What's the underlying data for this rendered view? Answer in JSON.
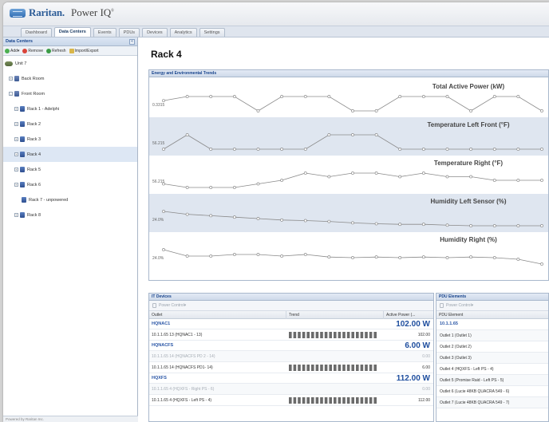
{
  "app": {
    "brand": "Raritan.",
    "product": "Power IQ",
    "trademark": "®"
  },
  "nav": {
    "tabs": [
      "Dashboard",
      "Data Centers",
      "Events",
      "PDUs",
      "Devices",
      "Analytics",
      "Settings"
    ],
    "active": "Data Centers"
  },
  "sidebar": {
    "title": "Data Centers",
    "collapse": "«",
    "toolbar": {
      "add": "Add▾",
      "remove": "Remove",
      "refresh": "Refresh",
      "import": "Import/Export"
    },
    "tree": [
      {
        "label": "Unit 7"
      },
      {
        "label": "Back Room",
        "expander": "+"
      },
      {
        "label": "Front Room",
        "expander": "-"
      },
      {
        "label": "Rack 1 - Adelphi",
        "expander": "+"
      },
      {
        "label": "Rack 2",
        "expander": "+"
      },
      {
        "label": "Rack 3",
        "expander": "+"
      },
      {
        "label": "Rack 4",
        "expander": "+"
      },
      {
        "label": "Rack 5",
        "expander": "+"
      },
      {
        "label": "Rack 6",
        "expander": "+"
      },
      {
        "label": "Rack 7 - unpowered"
      },
      {
        "label": "Rack 8",
        "expander": "+"
      }
    ],
    "footer": "Powered by Raritan Inc."
  },
  "main": {
    "title": "Rack 4",
    "trends_panel": "Energy and Environmental Trends"
  },
  "chart_data": [
    {
      "type": "line",
      "title": "Total Active Power (kW)",
      "start_label": "0.3315",
      "values": [
        0.3315,
        0.34,
        0.34,
        0.34,
        0.31,
        0.34,
        0.34,
        0.34,
        0.31,
        0.31,
        0.34,
        0.34,
        0.34,
        0.31,
        0.34,
        0.34,
        0.31
      ]
    },
    {
      "type": "line",
      "title": "Temperature Left Front (°F)",
      "start_label": "56.215",
      "values": [
        0,
        1,
        0,
        0,
        0,
        0,
        0,
        1,
        1,
        1,
        0,
        0,
        0,
        0,
        0,
        0,
        0
      ]
    },
    {
      "type": "line",
      "title": "Temperature Right (°F)",
      "start_label": "56.215",
      "values": [
        0.3,
        0.2,
        0.2,
        0.2,
        0.3,
        0.4,
        0.6,
        0.5,
        0.6,
        0.6,
        0.5,
        0.6,
        0.5,
        0.5,
        0.4,
        0.4,
        0.4
      ]
    },
    {
      "type": "line",
      "title": "Humidity Left Sensor (%)",
      "start_label": "24.0%",
      "values": [
        0.7,
        0.6,
        0.55,
        0.5,
        0.45,
        0.4,
        0.38,
        0.35,
        0.3,
        0.27,
        0.25,
        0.25,
        0.22,
        0.2,
        0.2,
        0.2,
        0.2
      ]
    },
    {
      "type": "line",
      "title": "Humidity Right (%)",
      "start_label": "24.0%",
      "values": [
        0.65,
        0.45,
        0.45,
        0.5,
        0.5,
        0.45,
        0.5,
        0.42,
        0.4,
        0.42,
        0.4,
        0.42,
        0.4,
        0.42,
        0.4,
        0.35,
        0.2
      ]
    }
  ],
  "it_devices": {
    "title": "IT Devices",
    "power_control": "Power Control▾",
    "columns": [
      "Outlet",
      "Trend",
      "Active Power (..."
    ],
    "groups": [
      {
        "name": "HQNAC1",
        "total": "102.00 W",
        "rows": [
          {
            "outlet": "10.1.1.65 13 (HQNAC1 - 13)",
            "value": "102.00",
            "dim": false,
            "bars": 20
          }
        ]
      },
      {
        "name": "HQNACFS",
        "total": "6.00 W",
        "rows": [
          {
            "outlet": "10.1.1.65 14 (HQNACFS PD 2 - 14)",
            "value": "0.00",
            "dim": true,
            "bars": 0
          },
          {
            "outlet": "10.1.1.65 14 (HQNACFS PD1- 14)",
            "value": "6.00",
            "dim": false,
            "bars": 20
          }
        ]
      },
      {
        "name": "HQXFS",
        "total": "112.00 W",
        "rows": [
          {
            "outlet": "10.1.1.65 4 (HQXFS - Right PS - 6)",
            "value": "0.00",
            "dim": true,
            "bars": 0
          },
          {
            "outlet": "10.1.1.65 4 (HQXFS - Left PS - 4)",
            "value": "112.00",
            "dim": false,
            "bars": 20
          }
        ]
      }
    ]
  },
  "pdu_elements": {
    "title": "PDU Elements",
    "power_control": "Power Control▾",
    "column": "PDU Element",
    "group": "10.1.1.65",
    "rows": [
      "Outlet 1 (Outlet 1)",
      "Outlet 2 (Outlet 2)",
      "Outlet 3 (Outlet 3)",
      "Outlet 4 (HQXFS - Left PS - 4)",
      "Outlet 5 (Promise Raid - Left PS - 5)",
      "Outlet 6 (Lucie 48KB QUACRA 549 - 6)",
      "Outlet 7 (Lucie 48KB QUACRA 549 - 7)"
    ]
  },
  "colors": {
    "accent": "#15428b",
    "link": "#2a56a6",
    "value": "#1d4d9e",
    "band": "#dfe6f0"
  }
}
